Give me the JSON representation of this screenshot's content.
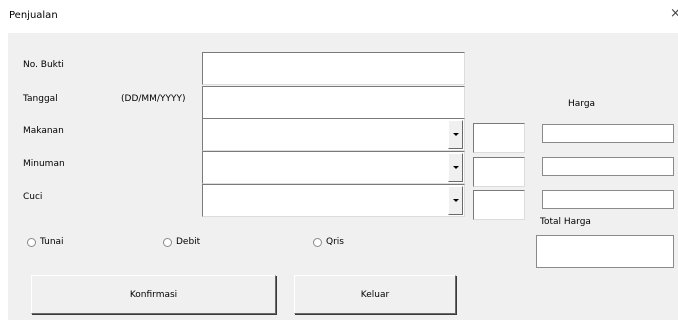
{
  "window": {
    "title": "Penjualan",
    "close_label": "×"
  },
  "form": {
    "no_bukti": {
      "label": "No. Bukti",
      "value": ""
    },
    "tanggal": {
      "label": "Tanggal",
      "format_hint": "(DD/MM/YYYY)",
      "value": ""
    },
    "makanan": {
      "label": "Makanan",
      "value": "",
      "qty": "",
      "harga": ""
    },
    "minuman": {
      "label": "Minuman",
      "value": "",
      "qty": "",
      "harga": ""
    },
    "cuci": {
      "label": "Cuci",
      "value": "",
      "qty": "",
      "harga": ""
    },
    "harga_header": "Harga",
    "total_harga": {
      "label": "Total Harga",
      "value": ""
    },
    "payment": [
      {
        "label": "Tunai",
        "selected": false
      },
      {
        "label": "Debit",
        "selected": false
      },
      {
        "label": "Qris",
        "selected": false
      }
    ],
    "buttons": {
      "konfirmasi": "Konfirmasi",
      "keluar": "Keluar"
    }
  }
}
